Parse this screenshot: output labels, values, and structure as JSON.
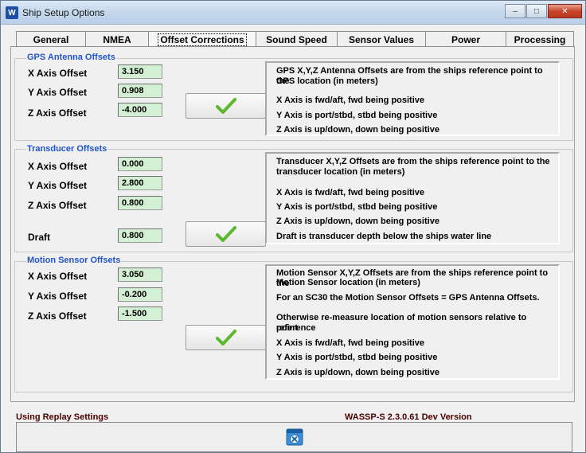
{
  "window": {
    "title": "Ship Setup Options",
    "app_icon": "W"
  },
  "tabs": [
    {
      "label": "General"
    },
    {
      "label": "NMEA"
    },
    {
      "label": "Offset Corrections"
    },
    {
      "label": "Sound Speed"
    },
    {
      "label": "Sensor Values"
    },
    {
      "label": "Power"
    },
    {
      "label": "Processing"
    }
  ],
  "active_tab": "Offset Corrections",
  "gps": {
    "title": "GPS Antenna Offsets",
    "fields": [
      {
        "label": "X Axis Offset",
        "value": "3.150"
      },
      {
        "label": "Y Axis Offset",
        "value": "0.908"
      },
      {
        "label": "Z Axis Offset",
        "value": "-4.000"
      }
    ],
    "info": [
      "GPS X,Y,Z Antenna Offsets are from the ships reference point  to the",
      "GPS location (in meters)",
      "X Axis is fwd/aft, fwd being positive",
      "Y Axis is port/stbd, stbd being positive",
      "Z Axis is up/down, down being positive"
    ]
  },
  "transducer": {
    "title": "Transducer Offsets",
    "fields": [
      {
        "label": "X Axis Offset",
        "value": "0.000"
      },
      {
        "label": "Y Axis Offset",
        "value": "2.800"
      },
      {
        "label": "Z Axis Offset",
        "value": "0.800"
      },
      {
        "label": "Draft",
        "value": "0.800"
      }
    ],
    "info": [
      "Transducer X,Y,Z Offsets are from the ships reference point to the",
      "transducer location (in meters)",
      "X Axis is fwd/aft, fwd being positive",
      "Y Axis is port/stbd, stbd being positive",
      "Z Axis is up/down, down being positive",
      "Draft is transducer depth below the ships water line"
    ]
  },
  "motion": {
    "title": "Motion Sensor Offsets",
    "fields": [
      {
        "label": "X Axis Offset",
        "value": "3.050"
      },
      {
        "label": "Y Axis Offset",
        "value": "-0.200"
      },
      {
        "label": "Z Axis Offset",
        "value": "-1.500"
      }
    ],
    "info": [
      "Motion Sensor X,Y,Z Offsets are from the ships reference point to the",
      "Motion Sensor location (in meters)",
      "For an SC30 the Motion Sensor Offsets = GPS Antenna Offsets.",
      "Otherwise re-measure location of motion sensors relative to  reference",
      "point",
      "X Axis is fwd/aft, fwd being positive",
      "Y Axis is port/stbd, stbd being positive",
      "Z Axis is up/down, down being positive"
    ]
  },
  "status": {
    "left": "Using Replay Settings",
    "right": "WASSP-S 2.3.0.61 Dev Version"
  },
  "colors": {
    "group_title": "#2255cc",
    "input_bg": "#d4f0d4",
    "status_text": "#4a0000",
    "check_green": "#5cb82c"
  },
  "icons": {
    "check": "checkmark-icon",
    "close_window": "close-window-icon",
    "app": "wassp-app-icon"
  }
}
